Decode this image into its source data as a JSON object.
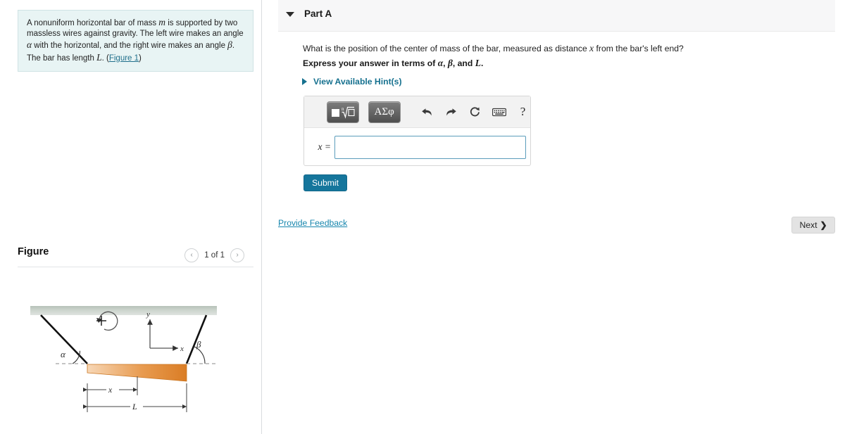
{
  "problem": {
    "text_line1": "A nonuniform horizontal bar of mass ",
    "symbol_m": "m",
    "text_line2": " is supported by two massless wires against gravity. The left wire makes an angle ",
    "symbol_alpha": "α",
    "text_line3": " with the horizontal, and the right wire makes an angle ",
    "symbol_beta": "β",
    "text_line4": ". The bar has length ",
    "symbol_L": "L",
    "text_line5": ". (",
    "figure_link": "Figure 1",
    "text_line6": ")"
  },
  "figure_panel": {
    "title": "Figure",
    "prev_icon": "‹",
    "next_icon": "›",
    "pager_label": "1 of 1",
    "diagram": {
      "angle_left": "α",
      "angle_right": "β",
      "axis_y": "y",
      "axis_x": "x",
      "rotation_sign": "+",
      "dim_x": "x",
      "dim_L": "L",
      "ceiling_color": "#c3cdc5",
      "bar_color": "#e2883c",
      "wire_color": "#111111"
    }
  },
  "part": {
    "title": "Part A",
    "toggle_icon": "caret-down-icon",
    "question": "What is the position of the center of mass of the bar, measured as distance ",
    "question_symbol": "x",
    "question_tail": " from the bar's left end?",
    "express_prefix": "Express your answer in terms of ",
    "express_alpha": "α",
    "express_comma1": ", ",
    "express_beta": "β",
    "express_and": ", and ",
    "express_L": "L",
    "express_period": ".",
    "hints_label": "View Available Hint(s)",
    "hints_arrow_icon": "caret-right-icon"
  },
  "answer": {
    "template_button": "■ⁿ√□",
    "greek_button": "ΑΣφ",
    "undo_icon": "undo-arrow-icon",
    "redo_icon": "redo-arrow-icon",
    "reset_icon": "reset-circular-arrow-icon",
    "keyboard_icon": "keyboard-icon",
    "help_icon": "?",
    "prefix_label": "x =",
    "input_value": "",
    "input_placeholder": ""
  },
  "actions": {
    "submit_label": "Submit",
    "feedback_label": "Provide Feedback",
    "next_label": "Next",
    "next_chevron": "❯"
  },
  "colors": {
    "accent_teal": "#15769c",
    "link_blue": "#1786ad",
    "problem_bg": "#e8f4f4",
    "header_bg": "#f7f7f8"
  }
}
